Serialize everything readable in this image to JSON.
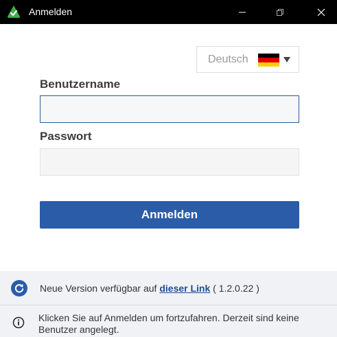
{
  "window": {
    "title": "Anmelden",
    "icon": "green-triangle-check-icon",
    "controls": [
      "minimize-icon",
      "maximize-icon",
      "close-icon"
    ]
  },
  "language": {
    "label": "Deutsch",
    "flag_colors": [
      "#000000",
      "#dd0000",
      "#ffce00"
    ]
  },
  "form": {
    "username_label": "Benutzername",
    "username_value": "",
    "password_label": "Passwort",
    "password_value": "",
    "login_button": "Anmelden"
  },
  "update": {
    "text_prefix": "Neue Version verfügbar auf",
    "link_text": "dieser Link",
    "version": "( 1.2.0.22 )"
  },
  "info": {
    "text": "Klicken Sie auf Anmelden um fortzufahren. Derzeit sind keine Benutzer angelegt."
  },
  "colors": {
    "accent": "#2a5ca8",
    "titlebar": "#000000",
    "app_icon": "#3fae4a"
  }
}
